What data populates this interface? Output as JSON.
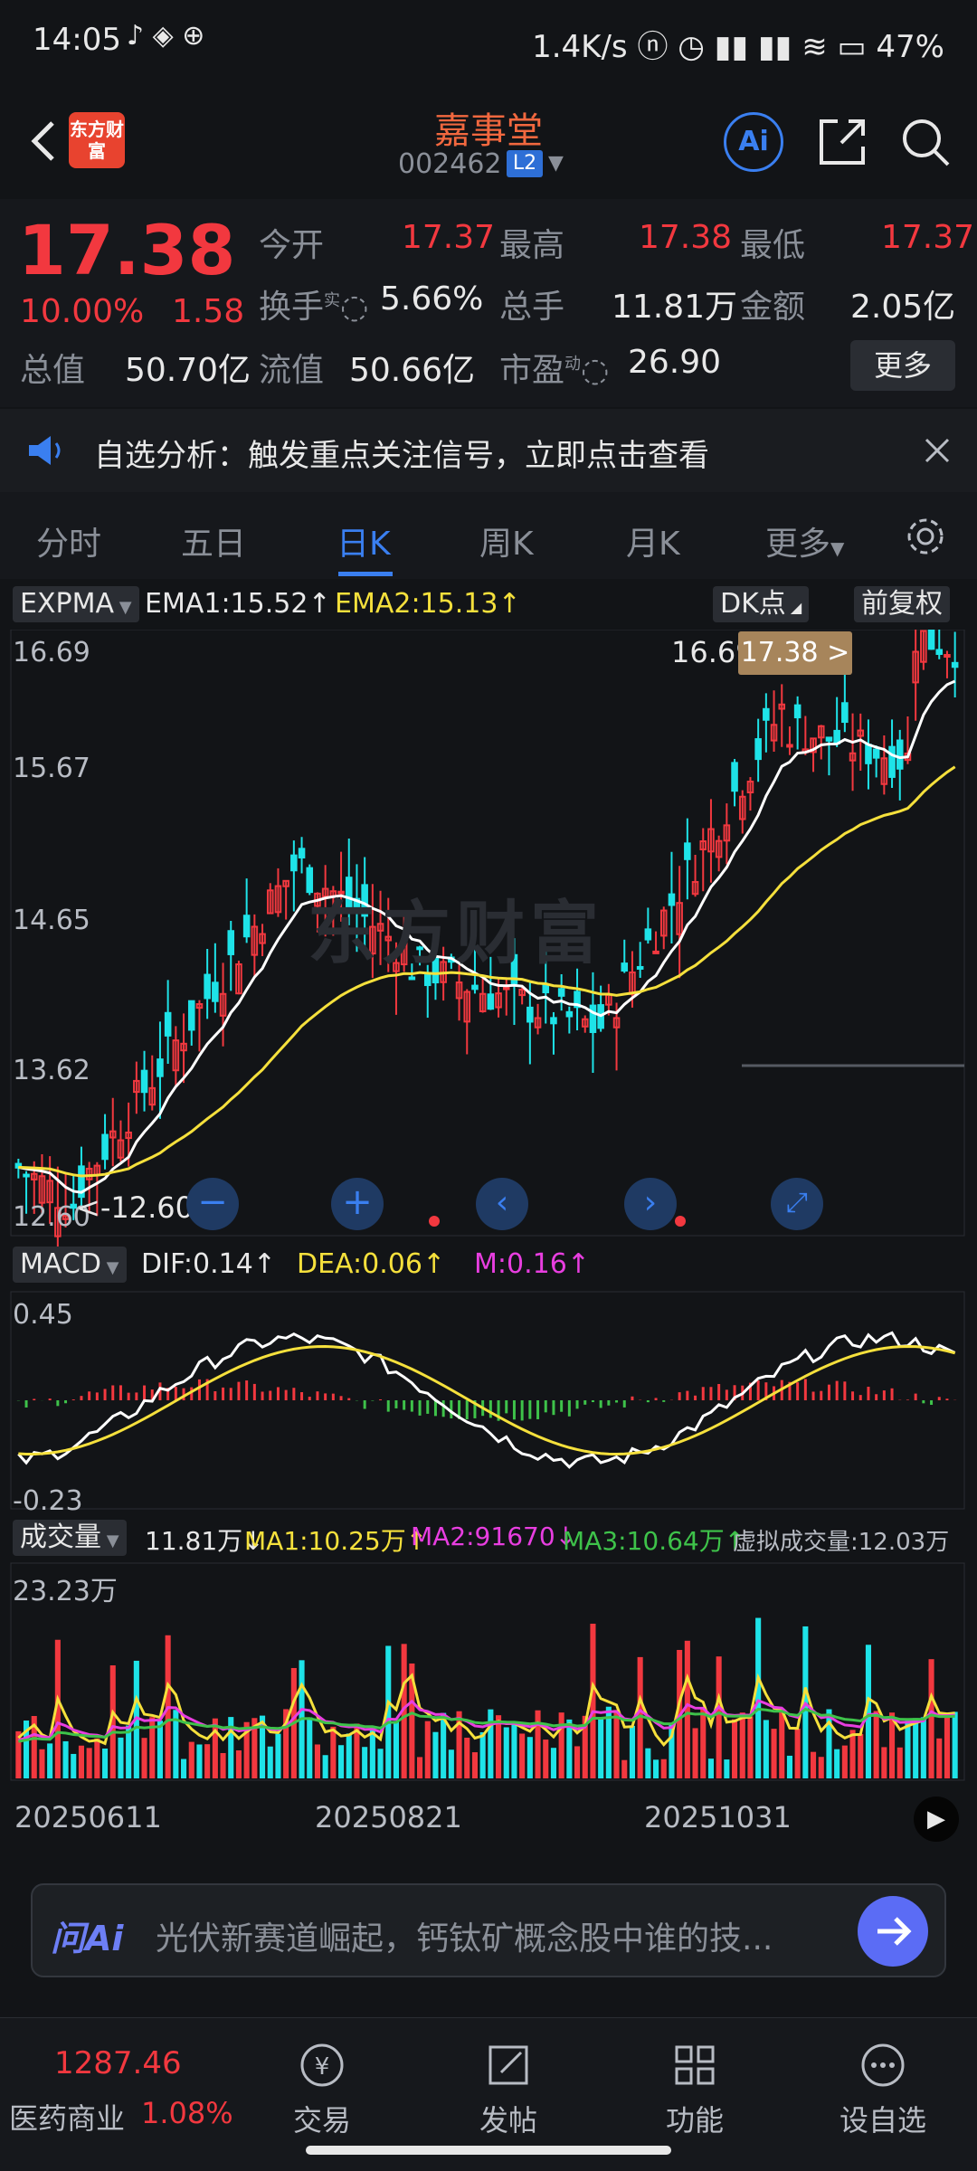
{
  "status_bar": {
    "time": "14:05",
    "network": "1.4K/s",
    "battery": "47%"
  },
  "header": {
    "title": "嘉事堂",
    "code": "002462",
    "badge": "L2",
    "logo_text": "东方财富",
    "ai_label": "Ai"
  },
  "quote": {
    "price": "17.38",
    "pct": "10.00%",
    "change": "1.58",
    "open_label": "今开",
    "open": "17.37",
    "high_label": "最高",
    "high": "17.38",
    "low_label": "最低",
    "low": "17.37",
    "turnover_label": "换手",
    "turnover_sup": "实",
    "turnover": "5.66%",
    "volume_label": "总手",
    "volume": "11.81万",
    "amount_label": "金额",
    "amount": "2.05亿",
    "mktcap_label": "总值",
    "mktcap": "50.70亿",
    "float_label": "流值",
    "float": "50.66亿",
    "pe_label": "市盈",
    "pe_sup": "动",
    "pe": "26.90",
    "more": "更多"
  },
  "notice": {
    "text": "自选分析：触发重点关注信号，立即点击查看"
  },
  "tabs": [
    {
      "label": "分时"
    },
    {
      "label": "五日"
    },
    {
      "label": "日K"
    },
    {
      "label": "周K"
    },
    {
      "label": "月K"
    },
    {
      "label": "更多"
    }
  ],
  "chart": {
    "indicator": "EXPMA",
    "ema1": "EMA1:15.52↑",
    "ema2": "EMA2:15.13↑",
    "dk": "DK点",
    "adj": "前复权",
    "y_ticks": [
      "16.69",
      "15.67",
      "14.65",
      "13.62",
      "12.60"
    ],
    "max_label": "16.69",
    "min_label": "<-12.60",
    "price_tag": "17.38 >",
    "watermark": "东方财富",
    "macd_name": "MACD",
    "dif": "DIF:0.14↑",
    "dea": "DEA:0.06↑",
    "m": "M:0.16↑",
    "macd_ticks": [
      "0.45",
      "-0.23"
    ],
    "vol_name": "成交量",
    "vol": "11.81万↓",
    "ma1": "MA1:10.25万↑",
    "ma2": "MA2:91670↓",
    "ma3": "MA3:10.64万↑",
    "virtual_vol": "虚拟成交量:12.03万",
    "vol_tick": "23.23万",
    "dates": [
      "20250611",
      "20250821",
      "20251031"
    ],
    "colors": {
      "up": "#f2383f",
      "down": "#1ee3e8",
      "ema1": "#ffffff",
      "ema2": "#f5e03c",
      "ma2": "#e83ee0",
      "ma3": "#3ec24a"
    }
  },
  "ai_bar": {
    "label": "问Ai",
    "placeholder": "光伏新赛道崛起，钙钛矿概念股中谁的技..."
  },
  "bottom_nav": {
    "index_value": "1287.46",
    "index_name": "医药商业",
    "index_pct": "1.08%",
    "items": [
      {
        "label": "交易"
      },
      {
        "label": "发帖"
      },
      {
        "label": "功能"
      },
      {
        "label": "设自选"
      }
    ]
  }
}
